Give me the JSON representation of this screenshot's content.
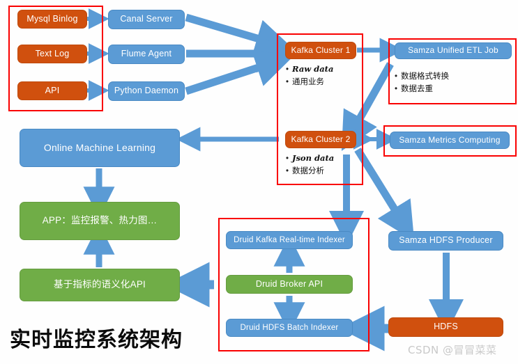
{
  "title": "实时监控系统架构",
  "watermark": "CSDN @冒冒菜菜",
  "colors": {
    "blue": "#5b9bd5",
    "orange": "#d0500e",
    "green": "#70ad47",
    "red_outline": "#f90000",
    "arrow": "#5b9bd5",
    "background": "#fefefe"
  },
  "sources": {
    "mysql_binlog": "Mysql Binlog",
    "text_log": "Text Log",
    "api": "API"
  },
  "collectors": {
    "canal_server": "Canal Server",
    "flume_agent": "Flume Agent",
    "python_daemon": "Python Daemon"
  },
  "kafka": {
    "cluster1": {
      "label": "Kafka Cluster 1",
      "bullets": [
        "Raw data",
        "通用业务"
      ]
    },
    "cluster2": {
      "label": "Kafka Cluster 2",
      "bullets": [
        "Json data",
        "数据分析"
      ]
    }
  },
  "samza": {
    "etl_job": {
      "label": "Samza Unified ETL Job",
      "bullets": [
        "数据格式转换",
        "数据去重"
      ]
    },
    "metrics": "Samza Metrics Computing",
    "hdfs_producer": "Samza HDFS Producer"
  },
  "storage": {
    "hdfs": "HDFS"
  },
  "druid": {
    "realtime_indexer": "Druid Kafka Real-time Indexer",
    "broker_api": "Druid Broker API",
    "batch_indexer": "Druid HDFS Batch Indexer"
  },
  "apps": {
    "online_ml": "Online Machine Learning",
    "app_layer": "APP：监控报警、热力图…",
    "semantic_api": "基于指标的语义化API"
  }
}
